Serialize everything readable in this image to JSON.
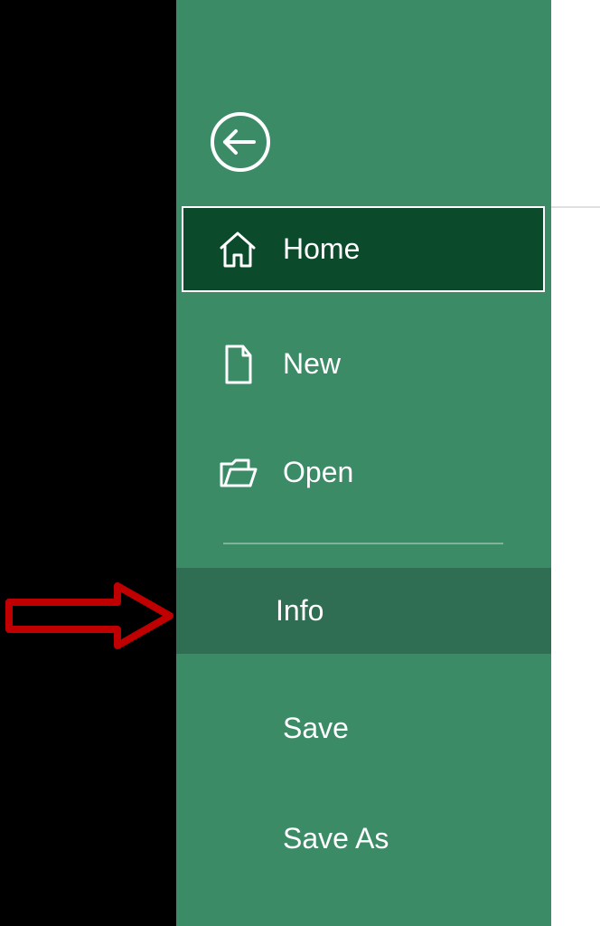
{
  "sidebar": {
    "back_label": "Back",
    "items": [
      {
        "label": "Home"
      },
      {
        "label": "New"
      },
      {
        "label": "Open"
      },
      {
        "label": "Info"
      },
      {
        "label": "Save"
      },
      {
        "label": "Save As"
      }
    ]
  },
  "annotation": {
    "arrow_target": "Info"
  }
}
